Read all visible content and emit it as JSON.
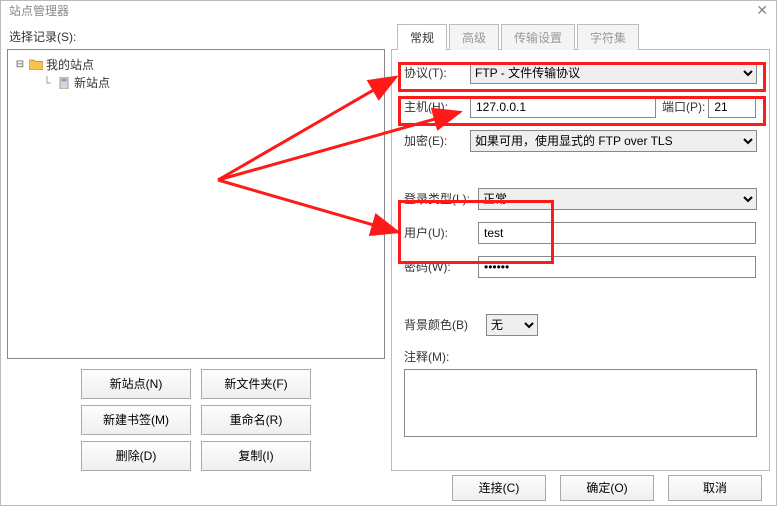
{
  "window": {
    "title": "站点管理器",
    "close_glyph": "✕"
  },
  "left": {
    "select_label": "选择记录(S):",
    "tree": {
      "root": "我的站点",
      "child": "新站点"
    },
    "buttons": {
      "new_site": "新站点(N)",
      "new_folder": "新文件夹(F)",
      "new_bookmark": "新建书签(M)",
      "rename": "重命名(R)",
      "delete": "删除(D)",
      "copy": "复制(I)"
    }
  },
  "tabs": {
    "general": "常规",
    "advanced": "高级",
    "transfer": "传输设置",
    "charset": "字符集"
  },
  "form": {
    "protocol_label": "协议(T):",
    "protocol_value": "FTP - 文件传输协议",
    "host_label": "主机(H):",
    "host_value": "127.0.0.1",
    "port_label": "端口(P):",
    "port_value": "21",
    "encryption_label": "加密(E):",
    "encryption_value": "如果可用，使用显式的 FTP over TLS",
    "logon_label": "登录类型(L):",
    "logon_value": "正常",
    "user_label": "用户(U):",
    "user_value": "test",
    "pass_label": "密码(W):",
    "pass_value": "••••••",
    "bgcolor_label": "背景颜色(B)",
    "bgcolor_value": "无",
    "comments_label": "注释(M):"
  },
  "footer": {
    "connect": "连接(C)",
    "ok": "确定(O)",
    "cancel": "取消"
  }
}
